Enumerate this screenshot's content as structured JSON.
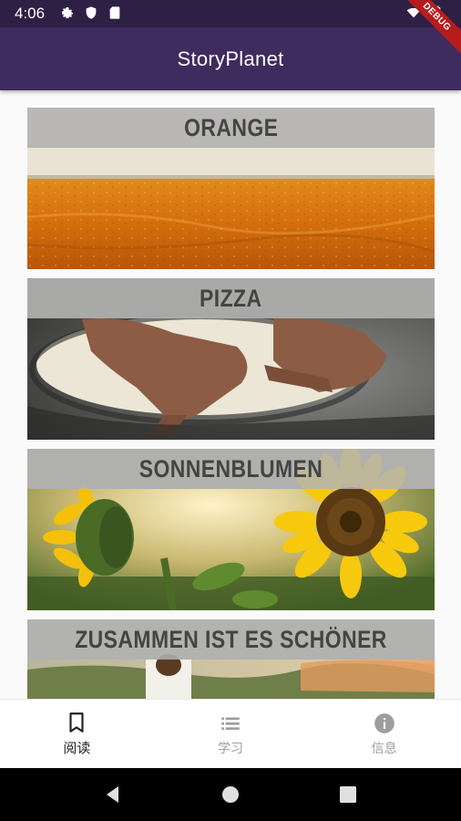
{
  "status_bar": {
    "time": "4:06",
    "debug_label": "DEBUG",
    "left_icons": [
      "gear-icon",
      "shield-icon",
      "sd-card-icon"
    ],
    "right_icons": [
      "wifi-icon",
      "battery-icon"
    ]
  },
  "app_bar": {
    "title": "StoryPlanet"
  },
  "stories": [
    {
      "title": "ORANGE",
      "image": "orange-wall-photo"
    },
    {
      "title": "PIZZA",
      "image": "pizza-dough-photo"
    },
    {
      "title": "SONNENBLUMEN",
      "image": "sunflowers-photo"
    },
    {
      "title": "ZUSAMMEN IST ES SCHÖNER",
      "image": "field-person-photo"
    }
  ],
  "bottom_nav": {
    "items": [
      {
        "label": "阅读",
        "icon": "bookmark-icon",
        "active": true
      },
      {
        "label": "学习",
        "icon": "list-icon",
        "active": false
      },
      {
        "label": "信息",
        "icon": "info-icon",
        "active": false
      }
    ]
  },
  "colors": {
    "status_bar": "#2e1f45",
    "app_bar": "#3f2b5e",
    "debug_ribbon": "#b71c1c"
  }
}
